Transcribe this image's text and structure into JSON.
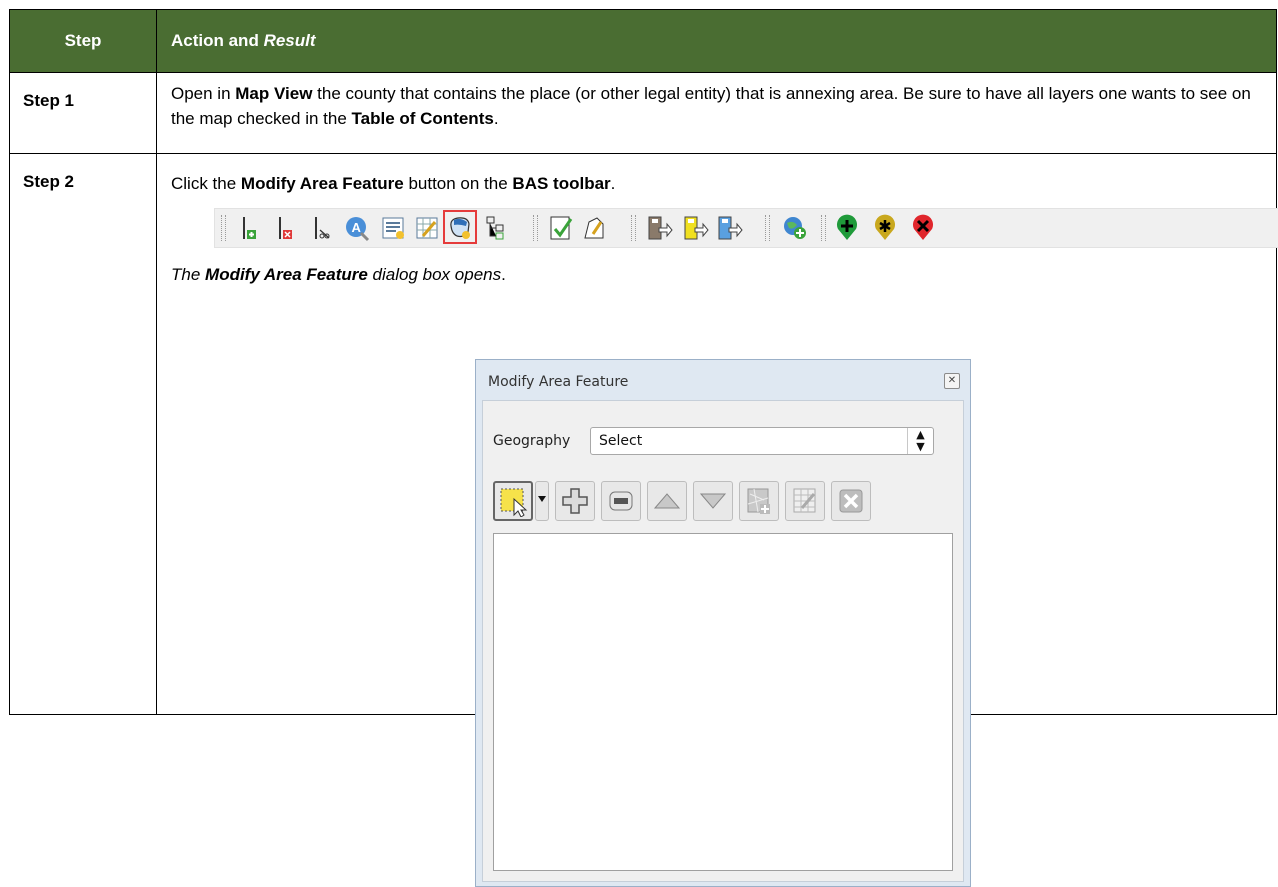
{
  "table": {
    "header": {
      "col1": "Step",
      "col2_prefix": "Action and ",
      "col2_emph": "Result"
    },
    "rows": [
      {
        "step": "Step 1",
        "text": {
          "t1": "Open in ",
          "b1": "Map View",
          "t2": " the county that contains the place (or other legal entity) that is annexing area. Be sure to have all layers one wants to see on the map checked in the ",
          "b2": "Table of Contents",
          "t3": "."
        }
      },
      {
        "step": "Step 2",
        "text": {
          "t1": "Click the ",
          "b1": "Modify Area Feature",
          "t2": " button on the ",
          "b2": "BAS toolbar",
          "t3": "."
        },
        "caption": {
          "prefix": "The ",
          "bold": "Modify Area Feature",
          "suffix": " dialog box opens",
          "end": "."
        }
      }
    ]
  },
  "toolbar": {
    "icons": [
      "add-line-icon",
      "delete-line-icon",
      "split-line-icon",
      "address-icon",
      "text-sheet-icon",
      "edit-sheet-icon",
      "modify-area-feature-icon",
      "tree-icon",
      "check-line-icon",
      "edit-polygon-icon",
      "import-icon",
      "export-icon",
      "transfer-icon",
      "globe-add-icon",
      "add-point-icon",
      "star-point-icon",
      "delete-point-icon"
    ],
    "highlighted": "modify-area-feature-icon"
  },
  "dialog": {
    "title": "Modify Area Feature",
    "geography_label": "Geography",
    "geography_value": "Select",
    "buttons": [
      "select-tool-icon",
      "dropdown-arrow-icon",
      "add-icon",
      "remove-icon",
      "move-up-icon",
      "move-down-icon",
      "map-add-icon",
      "edit-table-icon",
      "clear-icon"
    ]
  },
  "colors": {
    "header_bg": "#4a6d32",
    "highlight": "#e53b3b",
    "dialog_bg": "#dfe8f2"
  }
}
